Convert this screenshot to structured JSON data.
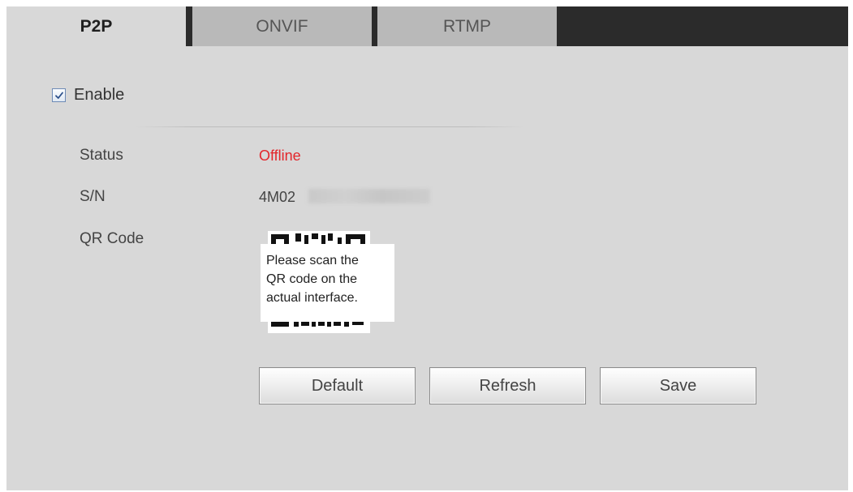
{
  "tabs": [
    {
      "label": "P2P",
      "active": true
    },
    {
      "label": "ONVIF",
      "active": false
    },
    {
      "label": "RTMP",
      "active": false
    }
  ],
  "enable": {
    "label": "Enable",
    "checked": true
  },
  "fields": {
    "status": {
      "label": "Status",
      "value": "Offline"
    },
    "sn": {
      "label": "S/N",
      "value": "4M02"
    },
    "qr": {
      "label": "QR Code",
      "tooltip_lines": [
        "Please scan the",
        "QR code on the",
        "actual interface."
      ]
    }
  },
  "buttons": {
    "default": "Default",
    "refresh": "Refresh",
    "save": "Save"
  },
  "colors": {
    "status_offline": "#e3262b",
    "active_tab_bg": "#d8d8d8",
    "inactive_tab_bg": "#b9b9b9",
    "tab_bar_bg": "#2b2b2b",
    "panel_bg": "#d8d8d8"
  }
}
